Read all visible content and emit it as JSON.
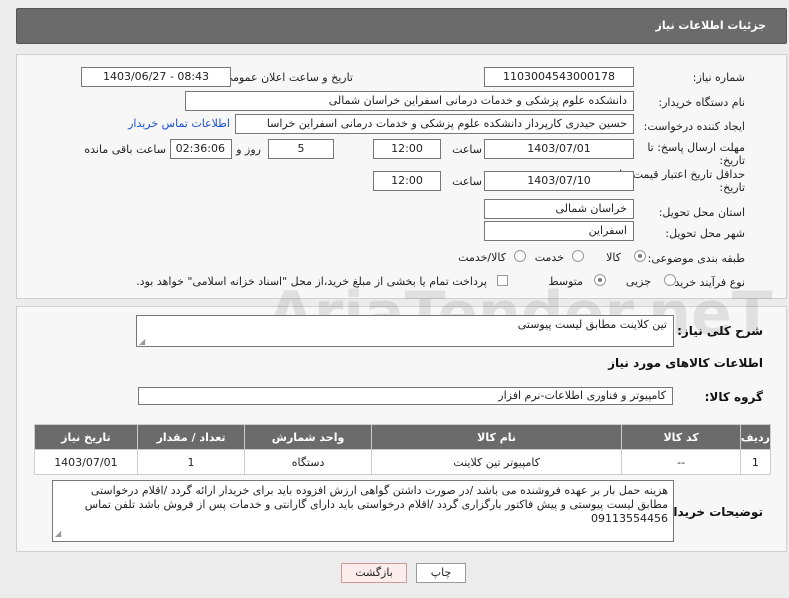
{
  "header": {
    "title": "جزئیات اطلاعات نیاز"
  },
  "fields": {
    "need_number_label": "شماره نیاز:",
    "need_number": "1103004543000178",
    "announce_label": "تاریخ و ساعت اعلان عمومی:",
    "announce_value": "1403/06/27 - 08:43",
    "buyer_org_label": "نام دستگاه خریدار:",
    "buyer_org": "دانشکده علوم پزشکی و خدمات درمانی اسفراین خراسان شمالی",
    "creator_label": "ایجاد کننده درخواست:",
    "creator": "حسین  حیدری کارپرداز دانشکده علوم پزشکی و خدمات درمانی اسفراین خراسا",
    "contact_link": "اطلاعات تماس خریدار",
    "deadline_label_1": "مهلت ارسال پاسخ: تا",
    "deadline_label_2": "تاریخ:",
    "deadline_date": "1403/07/01",
    "time_label": "ساعت",
    "deadline_time": "12:00",
    "days_value": "5",
    "days_label": "روز و",
    "remaining_value": "02:36:06",
    "remaining_label": "ساعت باقی مانده",
    "validity_label_1": "حداقل تاریخ اعتبار قیمت: تا",
    "validity_label_2": "تاریخ:",
    "validity_date": "1403/07/10",
    "validity_time_label": "ساعت",
    "validity_time": "12:00",
    "province_label": "استان محل تحویل:",
    "province": "خراسان شمالی",
    "city_label": "شهر محل تحویل:",
    "city": "اسفراین",
    "category_label": "طبقه بندی موضوعی:",
    "category_options": [
      "کالا",
      "خدمت",
      "کالا/خدمت"
    ],
    "process_label": "نوع فرآیند خرید :",
    "process_options": [
      "جزیی",
      "متوسط"
    ],
    "payment_note": "پرداخت تمام یا بخشی از مبلغ خرید،از محل \"اسناد خزانه اسلامی\" خواهد بود."
  },
  "details": {
    "summary_label": "شرح کلی نیاز:",
    "summary": "تین کلاینت مطابق لیست پیوستی",
    "goods_info_title": "اطلاعات کالاهای مورد نیاز",
    "goods_group_label": "گروه کالا:",
    "goods_group": "کامپیوتر و فناوری اطلاعات-نرم افزار",
    "table": {
      "headers": [
        "ردیف",
        "کد کالا",
        "نام کالا",
        "واحد شمارش",
        "تعداد / مقدار",
        "تاریخ نیاز"
      ],
      "rows": [
        [
          "1",
          "--",
          "کامپیوتر تین کلاینت",
          "دستگاه",
          "1",
          "1403/07/01"
        ]
      ]
    },
    "buyer_notes_label": "توضیحات خریدار:",
    "buyer_notes": "هزینه حمل بار بر عهده فروشنده می باشد /در صورت داشتن گواهی ارزش افزوده باید برای خریدار ارائه گردد /اقلام درخواستی مطابق لیست پیوستی و پیش فاکتور بارگزاری گردد /اقلام درخواستی باید دارای گارانتی و خدمات پس از فروش باشد تلفن تماس 09113554456"
  },
  "buttons": {
    "print": "چاپ",
    "back": "بازگشت"
  },
  "watermark": {
    "text": "AriaTender.neT"
  }
}
